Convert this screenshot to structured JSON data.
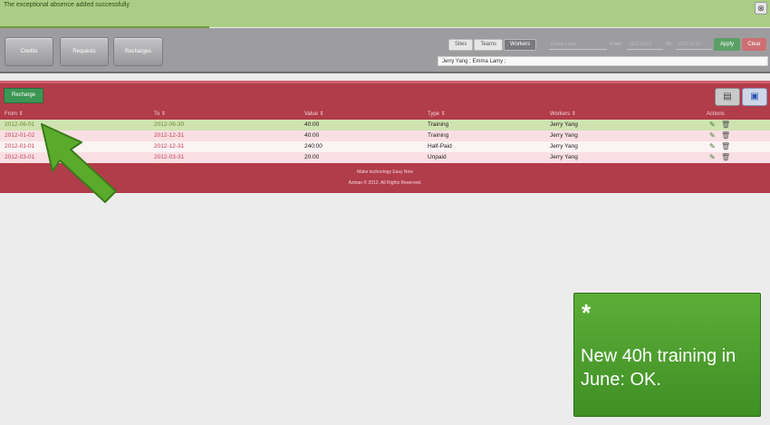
{
  "notification": {
    "message": "The exceptional absence added successfully",
    "progress_percent": 27,
    "close_icon": "close-icon"
  },
  "nav": {
    "tabs": [
      "Credits",
      "Requests",
      "Recharges"
    ]
  },
  "filters": {
    "tabs": [
      "Sites",
      "Teams",
      "Workers"
    ],
    "active_tab": "Workers",
    "worker_field": "Emma Lamy",
    "from_label": "From:",
    "from_value": "2012-01-01",
    "to_label": "To:",
    "to_value": "2012-12-31",
    "apply_label": "Apply",
    "clear_label": "Clear",
    "selected_workers": "Jerry Yang ; Emma Lamy ;"
  },
  "table": {
    "recharge_label": "Recharge",
    "view_icons": [
      "list-view-icon",
      "grid-view-icon"
    ],
    "columns": {
      "from": "From",
      "to": "To",
      "value": "Value",
      "type": "Type",
      "workers": "Workers",
      "actions": "Actions"
    },
    "sort_icon": "sort-icon",
    "rows": [
      {
        "from": "2012-06-01",
        "to": "2012-06-30",
        "value": "40:00",
        "type": "Training",
        "worker": "Jerry Yang",
        "highlighted": true
      },
      {
        "from": "2012-01-02",
        "to": "2012-12-31",
        "value": "40:00",
        "type": "Training",
        "worker": "Jerry Yang",
        "highlighted": false
      },
      {
        "from": "2012-01-01",
        "to": "2012-12-31",
        "value": "240:00",
        "type": "Half-Paid",
        "worker": "Jerry Yang",
        "highlighted": false
      },
      {
        "from": "2012-03-01",
        "to": "2012-03-31",
        "value": "20:00",
        "type": "Unpaid",
        "worker": "Jerry Yang",
        "highlighted": false
      }
    ],
    "row_action_icons": [
      "edit-icon",
      "delete-icon"
    ]
  },
  "footer": {
    "tagline": "Make technology Easy Now",
    "copyright": "Azinao © 2012. All Rights Reserved."
  },
  "callout": {
    "star": "*",
    "text": "New 40h training in June: OK."
  },
  "colors": {
    "notice": "#a9cd84",
    "panel": "#b13c4a",
    "highlight_row": "#cfe3b0",
    "pink_row": "#f9dfe3",
    "white_row": "#fbf3f4",
    "callout": "#4e9f2f",
    "accent_green": "#3c9655"
  }
}
